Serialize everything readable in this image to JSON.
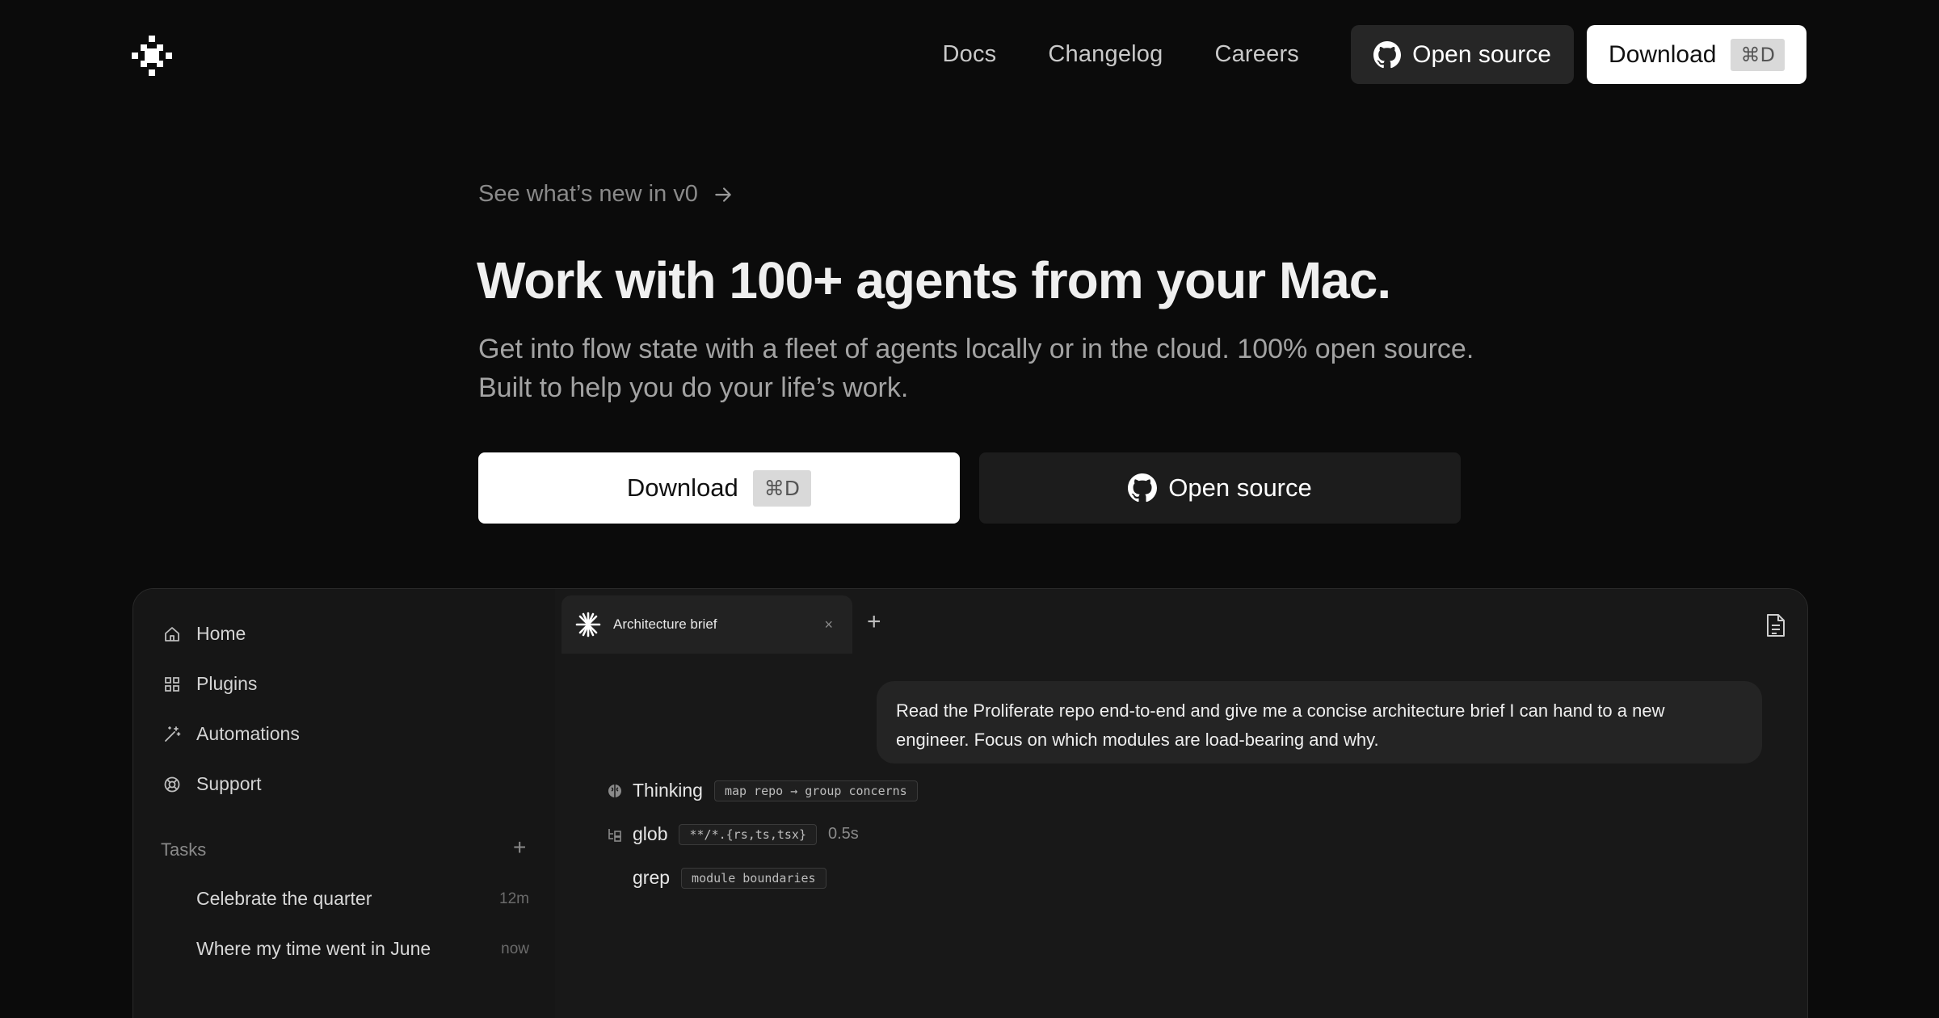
{
  "nav": {
    "links": [
      "Docs",
      "Changelog",
      "Careers"
    ],
    "open_source_label": "Open source",
    "download_label": "Download",
    "download_shortcut": "⌘D"
  },
  "hero": {
    "announcement": "See what’s new in v0",
    "title": "Work with 100+ agents from your Mac.",
    "subtitle_line1": "Get into flow state with a fleet of agents locally or in the cloud. 100% open source.",
    "subtitle_line2": "Built to help you do your life’s work.",
    "download_label": "Download",
    "download_shortcut": "⌘D",
    "open_source_label": "Open source"
  },
  "app": {
    "sidebar": {
      "items": [
        {
          "label": "Home",
          "icon": "home-icon"
        },
        {
          "label": "Plugins",
          "icon": "grid-icon"
        },
        {
          "label": "Automations",
          "icon": "magic-wand-icon"
        },
        {
          "label": "Support",
          "icon": "lifebuoy-icon"
        }
      ],
      "tasks_heading": "Tasks",
      "tasks": [
        {
          "title": "Celebrate the quarter",
          "time": "12m"
        },
        {
          "title": "Where my time went in June",
          "time": "now"
        }
      ]
    },
    "tab": {
      "label": "Architecture brief",
      "icon": "sparkle-icon",
      "close": "×",
      "add": "+"
    },
    "message": "Read the Proliferate repo end-to-end and give me a concise architecture brief I can hand to a new engineer. Focus on which modules are load-bearing and why.",
    "steps": [
      {
        "label": "Thinking",
        "detail": "map repo → group concerns",
        "duration": "",
        "icon": "brain-icon"
      },
      {
        "label": "glob",
        "detail": "**/*.{rs,ts,tsx}",
        "duration": "0.5s",
        "icon": "file-tree-icon"
      },
      {
        "label": "grep",
        "detail": "module boundaries",
        "duration": "",
        "icon": ""
      }
    ]
  },
  "colors": {
    "background": "#0b0b0b",
    "accent_button": "#ffffff",
    "secondary_button": "#262626"
  }
}
